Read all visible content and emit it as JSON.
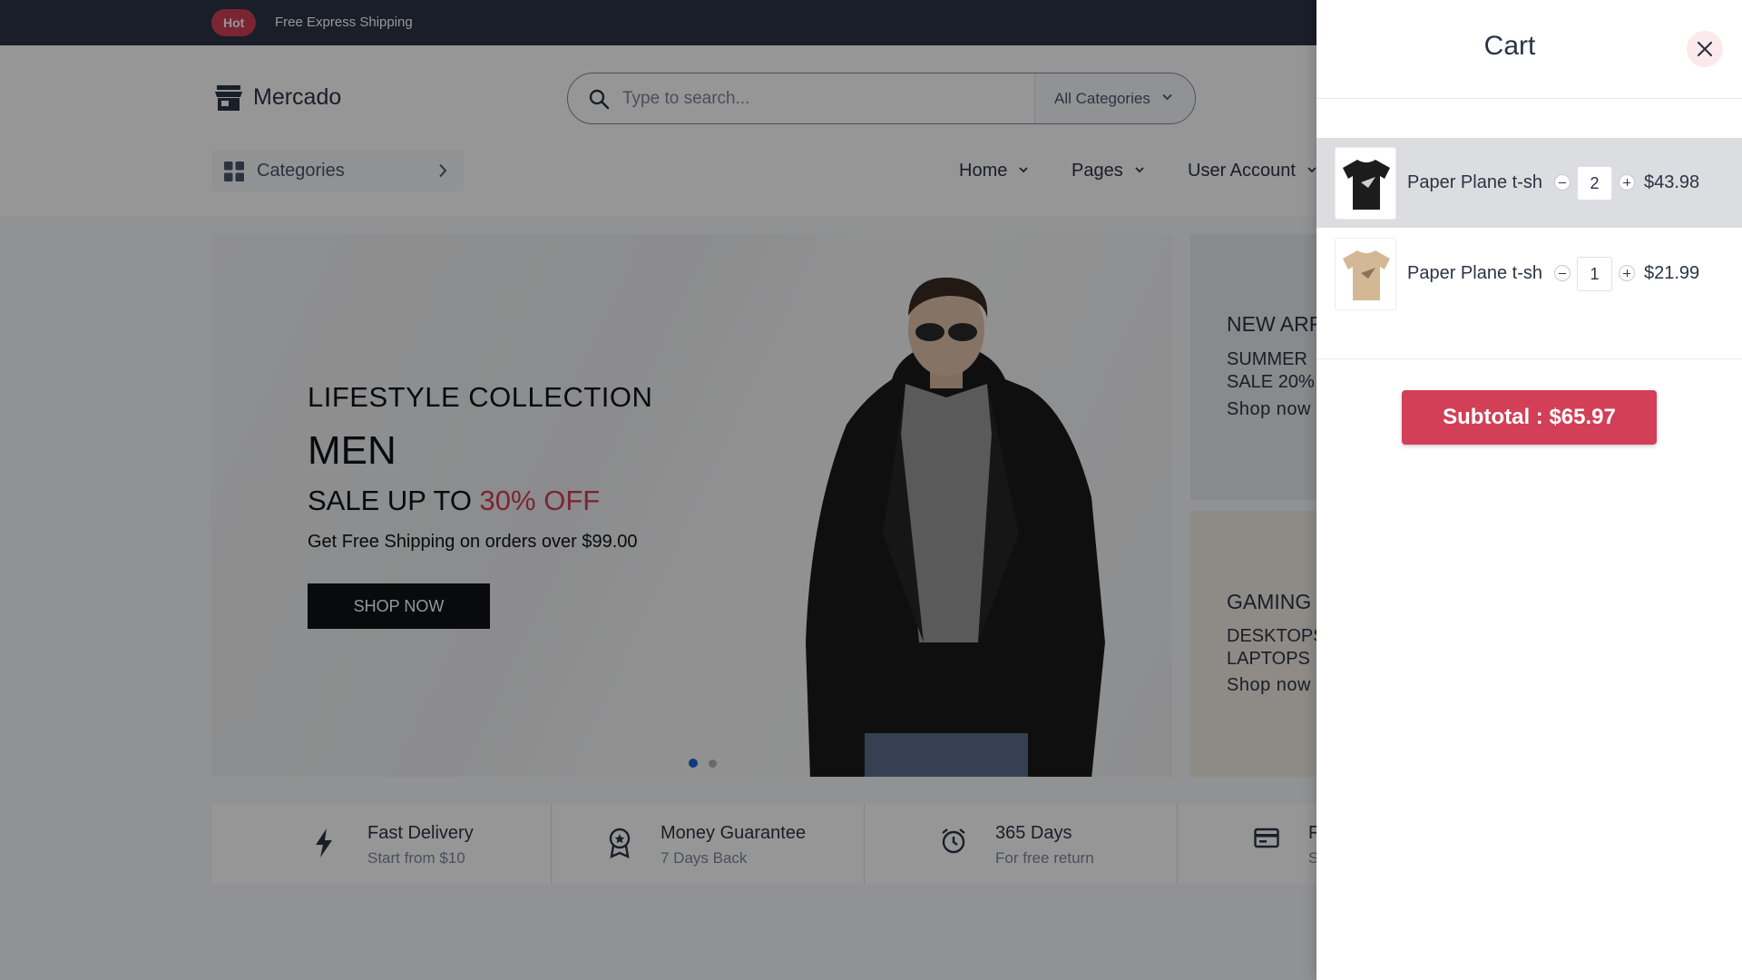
{
  "topbar": {
    "badge": "Hot",
    "text": "Free Express Shipping"
  },
  "header": {
    "logo": "Mercado",
    "search_placeholder": "Type to search...",
    "category_select": "All Categories",
    "categories_button": "Categories",
    "nav": [
      "Home",
      "Pages",
      "User Account"
    ]
  },
  "hero": {
    "line1": "LIFESTYLE COLLECTION",
    "line2": "MEN",
    "line3_prefix": "SALE UP TO ",
    "line3_highlight": "30% OFF",
    "line4": "Get Free Shipping on orders over $99.00",
    "cta": "SHOP NOW",
    "slides": 2,
    "active_slide": 1
  },
  "promos": [
    {
      "title": "NEW ARR",
      "sub1": "SUMMER",
      "sub2": "SALE 20%",
      "link": "Shop now"
    },
    {
      "title": "GAMING",
      "sub1": "DESKTOPS",
      "sub2": "LAPTOPS",
      "link": "Shop now"
    }
  ],
  "services": [
    {
      "icon": "lightning-icon",
      "title": "Fast Delivery",
      "subtitle": "Start from $10"
    },
    {
      "icon": "badge-icon",
      "title": "Money Guarantee",
      "subtitle": "7 Days Back"
    },
    {
      "icon": "alarm-clock-icon",
      "title": "365 Days",
      "subtitle": "For free return"
    },
    {
      "icon": "credit-card-icon",
      "title": "F",
      "subtitle": "S"
    }
  ],
  "cart": {
    "title": "Cart",
    "items": [
      {
        "name": "Paper Plane t-sh",
        "qty": "2",
        "price": "$43.98",
        "color": "#1c1c1c"
      },
      {
        "name": "Paper Plane t-sh",
        "qty": "1",
        "price": "$21.99",
        "color": "#d4b794"
      }
    ],
    "subtotal": "Subtotal : $65.97"
  },
  "colors": {
    "primary": "#d23f57",
    "dark": "#2b3445",
    "overlay": "rgba(0,0,0,0.41)"
  }
}
